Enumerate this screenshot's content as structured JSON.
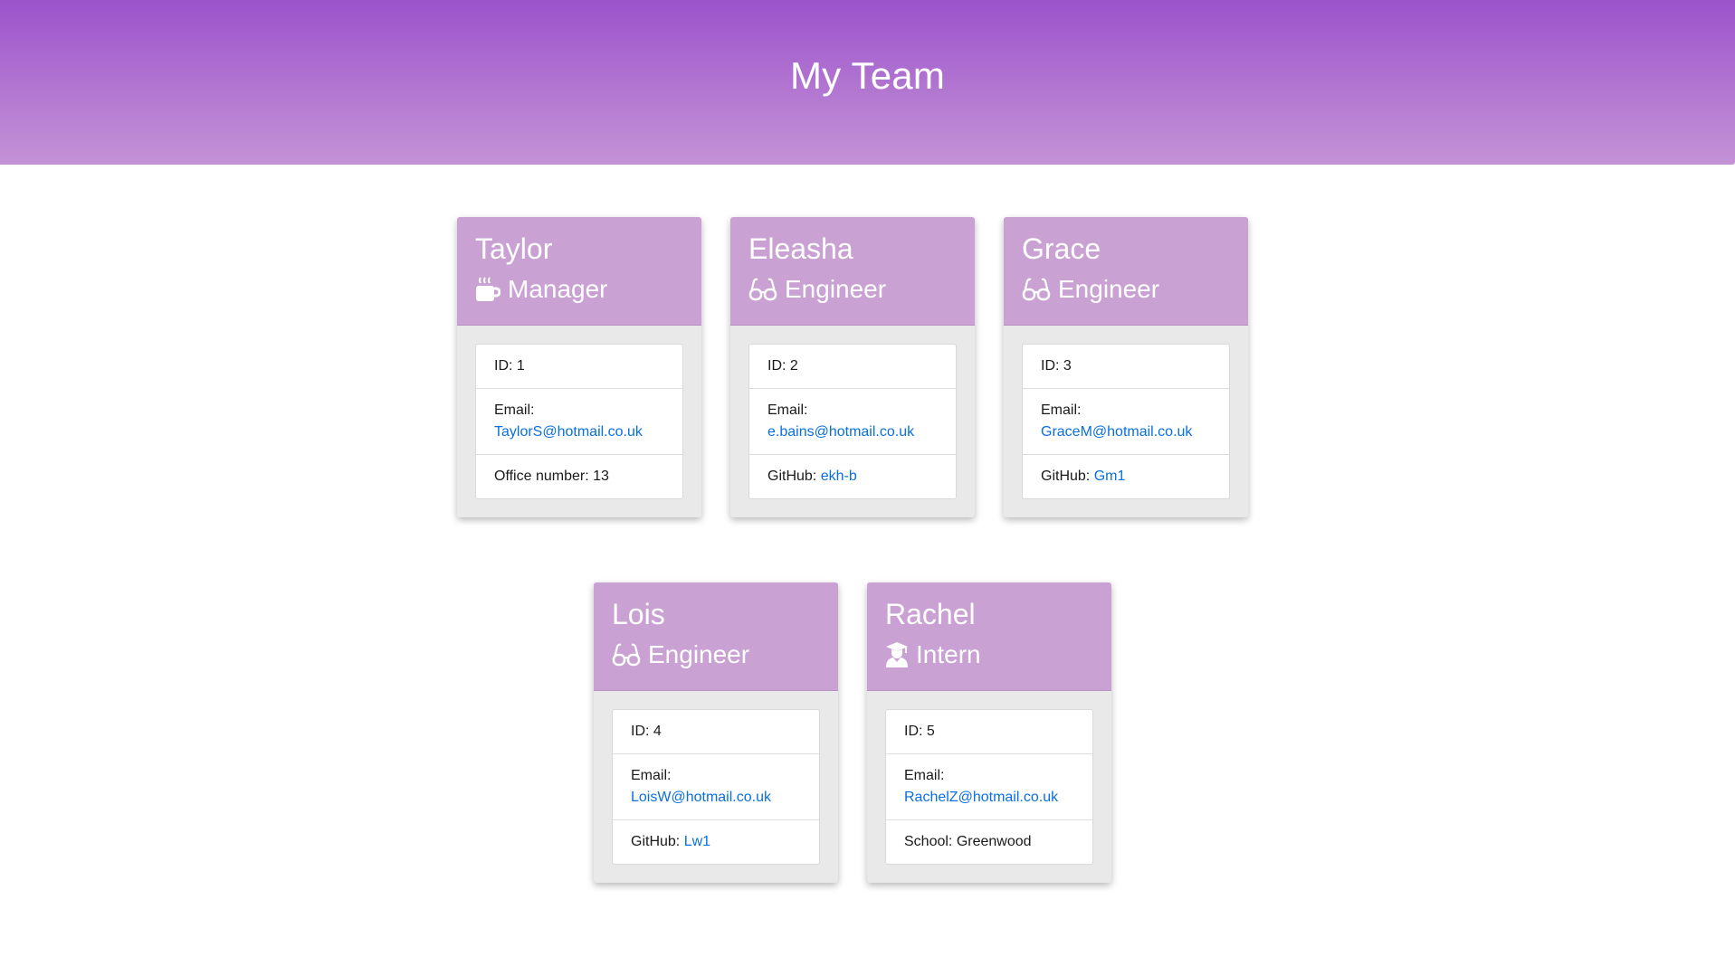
{
  "header": {
    "title": "My Team"
  },
  "labels": {
    "id": "ID: ",
    "email": "Email:",
    "office": "Office number: ",
    "github": "GitHub: ",
    "school": "School: "
  },
  "cards": [
    {
      "name": "Taylor",
      "role": "Manager",
      "icon": "coffee-icon",
      "id": "1",
      "email": "TaylorS@hotmail.co.uk",
      "office": "13"
    },
    {
      "name": "Eleasha",
      "role": "Engineer",
      "icon": "glasses-icon",
      "id": "2",
      "email": "e.bains@hotmail.co.uk",
      "github": "ekh-b"
    },
    {
      "name": "Grace",
      "role": "Engineer",
      "icon": "glasses-icon",
      "id": "3",
      "email": "GraceM@hotmail.co.uk",
      "github": "Gm1"
    },
    {
      "name": "Lois",
      "role": "Engineer",
      "icon": "glasses-icon",
      "id": "4",
      "email": "LoisW@hotmail.co.uk",
      "github": "Lw1"
    },
    {
      "name": "Rachel",
      "role": "Intern",
      "icon": "graduate-icon",
      "id": "5",
      "email": "RachelZ@hotmail.co.uk",
      "school": "Greenwood"
    }
  ],
  "colors": {
    "header_top": "#9c53cb",
    "header_bottom": "#c493d6",
    "card_header": "#caa1d3",
    "link": "#0a6fe0"
  }
}
